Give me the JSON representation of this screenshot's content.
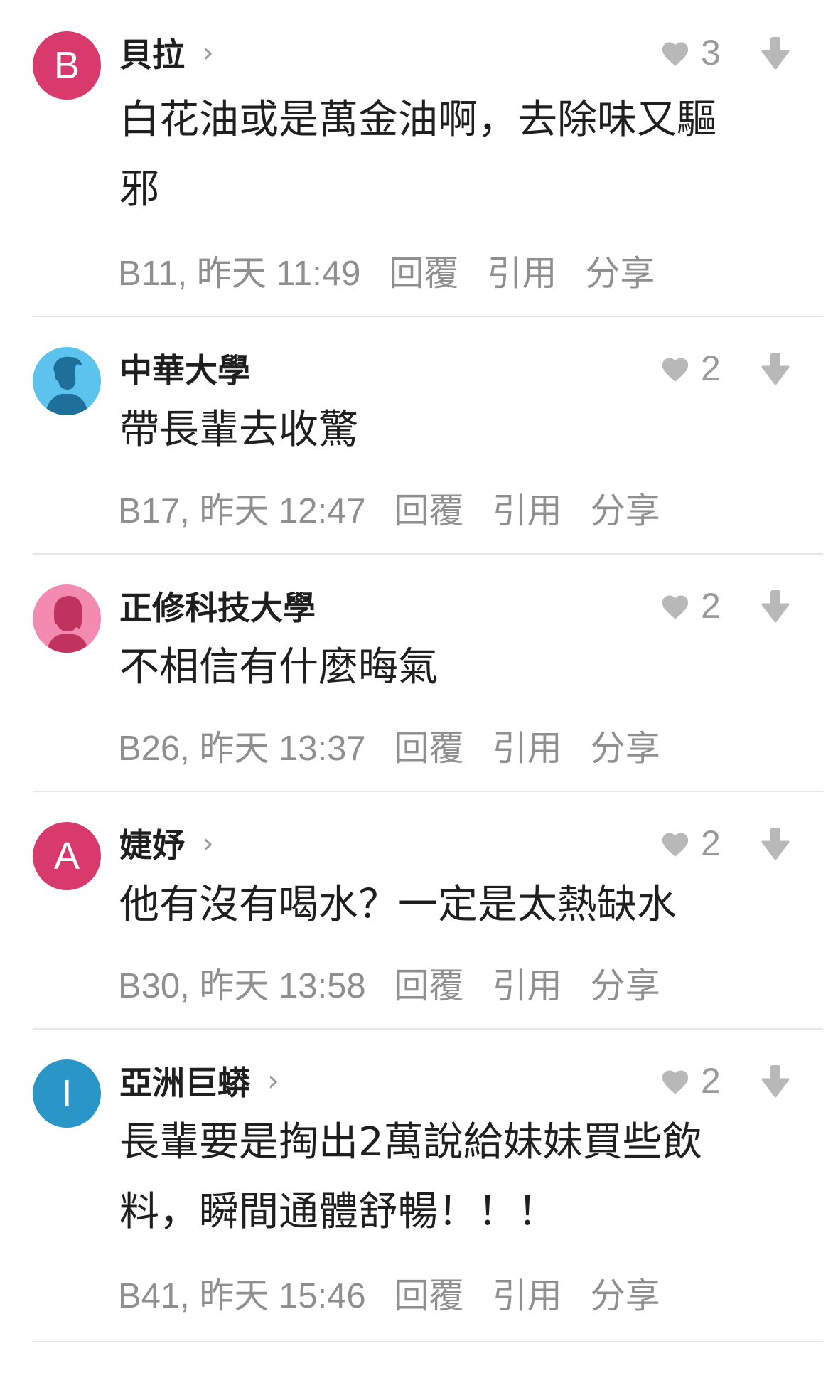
{
  "colors": {
    "text": "#1f1f1f",
    "meta": "#8f8f8f",
    "icon_gray": "#b8b8b8",
    "divider": "#e6e6e6"
  },
  "comments": [
    {
      "avatar": {
        "type": "letter",
        "letter": "B",
        "color": "#d93a6c"
      },
      "author": "貝拉",
      "has_chevron": true,
      "chevron": "›",
      "likes": "3",
      "body": "白花油或是萬金油啊，去除味又驅\n邪",
      "floor_time": "B11, 昨天 11:49",
      "actions": [
        "回覆",
        "引用",
        "分享"
      ]
    },
    {
      "avatar": {
        "type": "icon",
        "icon": "male-silhouette-icon",
        "color": "#5cc3ee"
      },
      "author": "中華大學",
      "has_chevron": false,
      "chevron": "",
      "likes": "2",
      "body": "帶長輩去收驚",
      "floor_time": "B17, 昨天 12:47",
      "actions": [
        "回覆",
        "引用",
        "分享"
      ]
    },
    {
      "avatar": {
        "type": "icon",
        "icon": "female-silhouette-icon",
        "color": "#f38ab0"
      },
      "author": "正修科技大學",
      "has_chevron": false,
      "chevron": "",
      "likes": "2",
      "body": "不相信有什麼晦氣",
      "floor_time": "B26, 昨天 13:37",
      "actions": [
        "回覆",
        "引用",
        "分享"
      ]
    },
    {
      "avatar": {
        "type": "letter",
        "letter": "A",
        "color": "#d93a6c"
      },
      "author": "婕妤",
      "has_chevron": true,
      "chevron": "›",
      "likes": "2",
      "body": "他有沒有喝水？一定是太熱缺水",
      "floor_time": "B30, 昨天 13:58",
      "actions": [
        "回覆",
        "引用",
        "分享"
      ]
    },
    {
      "avatar": {
        "type": "letter",
        "letter": "I",
        "color": "#2a96c8"
      },
      "author": "亞洲巨蟒",
      "has_chevron": true,
      "chevron": "›",
      "likes": "2",
      "body": "長輩要是掏出2萬說給妹妹買些飲\n料，瞬間通體舒暢！！！",
      "floor_time": "B41, 昨天 15:46",
      "actions": [
        "回覆",
        "引用",
        "分享"
      ]
    }
  ]
}
